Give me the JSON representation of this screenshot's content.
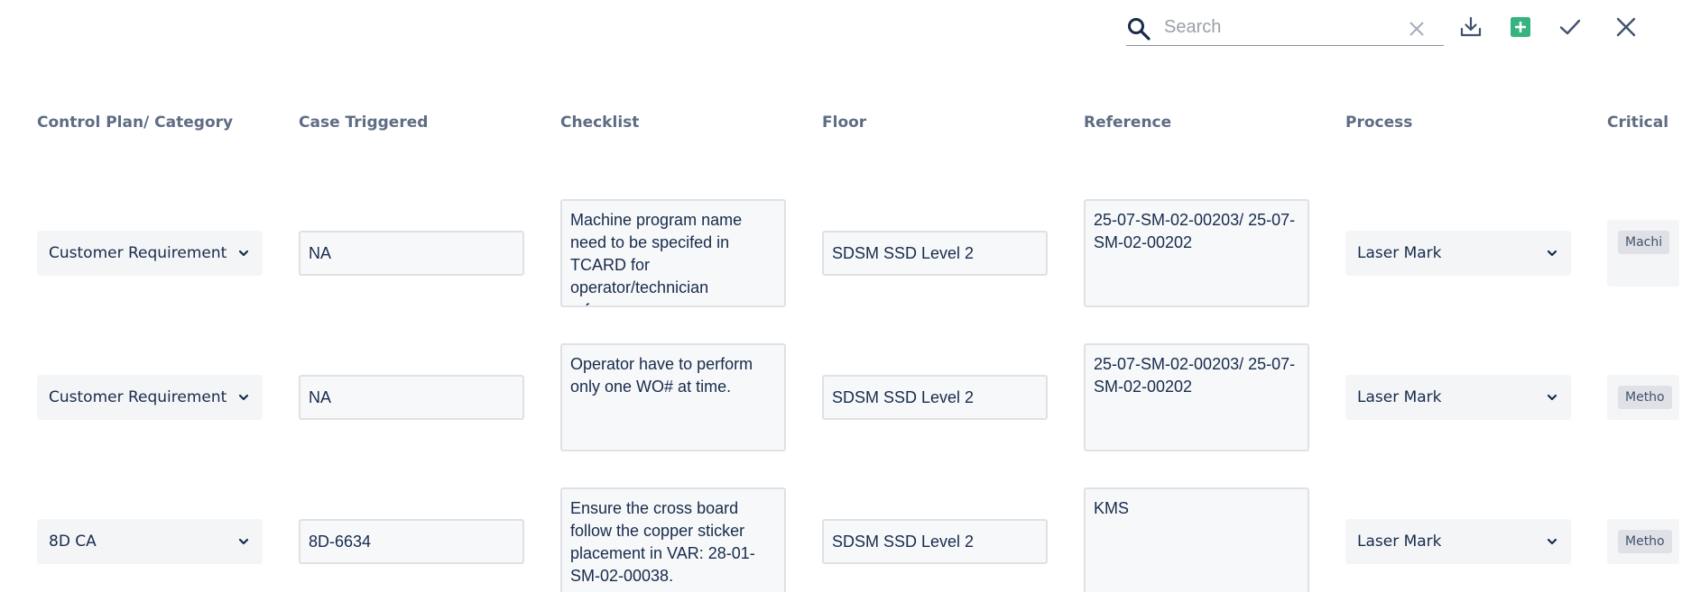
{
  "toolbar": {
    "search_placeholder": "Search",
    "search_value": "",
    "icons": {
      "search": "search-icon",
      "clear": "close-icon",
      "download": "download-icon",
      "add": "add-square-icon",
      "confirm": "check-icon",
      "close": "close-icon"
    },
    "accent_add": "#36b37e"
  },
  "table": {
    "columns": [
      "Control Plan/ Category",
      "Case Triggered",
      "Checklist",
      "Floor",
      "Reference",
      "Process",
      "Critical"
    ],
    "rows": [
      {
        "category": "Customer Requirement",
        "case_triggered": "NA",
        "checklist": "Machine program name need to be specifed in TCARD for operator/technician reference.",
        "floor": "SDSM SSD Level 2",
        "reference": "25-07-SM-02-00203/ 25-07-SM-02-00202",
        "process": "Laser Mark",
        "critical": "Machi"
      },
      {
        "category": "Customer Requirement",
        "case_triggered": "NA",
        "checklist": "Operator have to perform only one WO# at time.",
        "floor": "SDSM SSD Level 2",
        "reference": "25-07-SM-02-00203/ 25-07-SM-02-00202",
        "process": "Laser Mark",
        "critical": "Metho"
      },
      {
        "category": "8D CA",
        "case_triggered": "8D-6634",
        "checklist": "Ensure the cross board follow the copper sticker placement in VAR: 28-01-SM-02-00038.",
        "floor": "SDSM SSD Level 2",
        "reference": "KMS",
        "process": "Laser Mark",
        "critical": "Metho"
      }
    ]
  }
}
